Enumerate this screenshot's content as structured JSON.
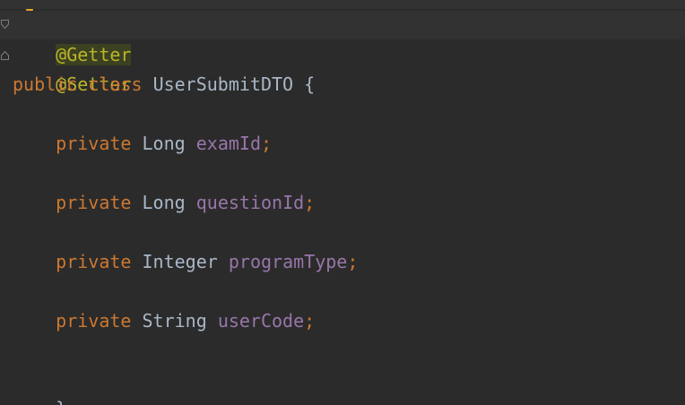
{
  "editor": {
    "lines": {
      "l1": {
        "annotation": "@Getter"
      },
      "l2": {
        "annotation": "@Setter"
      },
      "l3": {
        "kw1": "public",
        "kw2": "class",
        "name": "UserSubmitDTO",
        "brace": "{"
      },
      "l4": {
        "kw": "private",
        "type": "Long",
        "field": "examId",
        "semi": ";"
      },
      "l5": {
        "kw": "private",
        "type": "Long",
        "field": "questionId",
        "semi": ";"
      },
      "l6": {
        "kw": "private",
        "type": "Integer",
        "field": "programType",
        "semi": ";"
      },
      "l7": {
        "kw": "private",
        "type": "String",
        "field": "userCode",
        "semi": ";"
      },
      "l8": {
        "brace": "}"
      }
    },
    "icons": {
      "intention": "lightbulb-icon",
      "fold": "fold-marker-icon"
    },
    "colors": {
      "background": "#2b2b2b",
      "annotation": "#bbb529",
      "keyword": "#cc7832",
      "field": "#9876aa",
      "text": "#a9b7c6"
    }
  }
}
